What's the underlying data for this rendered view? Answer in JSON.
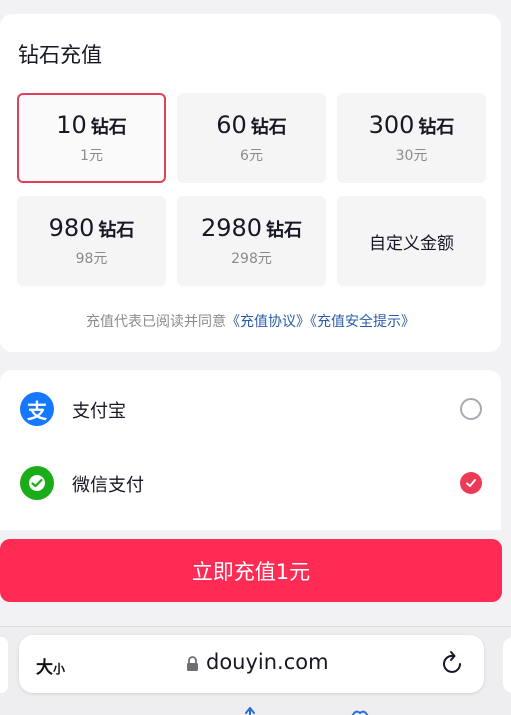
{
  "recharge": {
    "title": "钻石充值",
    "packages": [
      {
        "amount": "10",
        "unit": "钻石",
        "price": "1元",
        "selected": true
      },
      {
        "amount": "60",
        "unit": "钻石",
        "price": "6元",
        "selected": false
      },
      {
        "amount": "300",
        "unit": "钻石",
        "price": "30元",
        "selected": false
      },
      {
        "amount": "980",
        "unit": "钻石",
        "price": "98元",
        "selected": false
      },
      {
        "amount": "2980",
        "unit": "钻石",
        "price": "298元",
        "selected": false
      }
    ],
    "custom_label": "自定义金额",
    "agreement_prefix": "充值代表已阅读并同意",
    "agreement_link1": "《充值协议》",
    "agreement_link2": "《充值安全提示》"
  },
  "payment": {
    "methods": [
      {
        "label": "支付宝",
        "icon": "alipay-icon",
        "icon_glyph": "支",
        "color": "#1677ff",
        "selected": false
      },
      {
        "label": "微信支付",
        "icon": "wechat-pay-icon",
        "color": "#1aad19",
        "selected": true
      }
    ]
  },
  "cta": {
    "label": "立即充值1元",
    "color": "#fe2c55"
  },
  "browser": {
    "text_size_big": "大",
    "text_size_small": "小",
    "url": "douyin.com"
  },
  "colors": {
    "accent": "#fe2c55",
    "link": "#2a5ca8",
    "selected_border": "#e0405a"
  }
}
